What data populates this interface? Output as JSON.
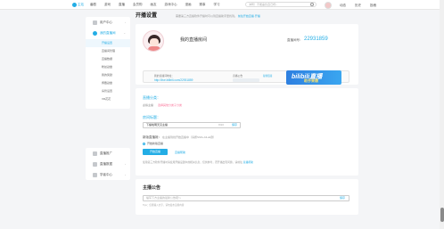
{
  "topbar": {
    "logo_text": "主站",
    "nav": [
      "番剧",
      "游戏",
      "直播",
      "会员购",
      "画友",
      "游戏中心",
      "漫画",
      "赛事",
      "学习"
    ],
    "search_placeholder": "冲鸭！不能辜负自己呀~",
    "right": [
      "动态",
      "历史",
      "投稿"
    ]
  },
  "sidebar": {
    "user_center": "用户中心",
    "live_center": "我的直播间",
    "sub_items": [
      "开播设置",
      "直播间管理",
      "直播数据",
      "粉丝勋章",
      "我的奖励",
      "佩戴勋章",
      "房管设置",
      "XR花花"
    ],
    "live_promo": "直播推广",
    "live_data": "直播数据",
    "my_center": "学者中心"
  },
  "main": {
    "page_title": "开播设置",
    "notice": "需要第三方直播软件开播时可以到直播助手里找到。",
    "notice_link": "前往开始直播·开播",
    "room": {
      "name": "我的直播房间",
      "id_label": "直播间号：",
      "id": "22931859",
      "link_label": "我的直播间地址：",
      "url": "http://live.bilibili.com/22931859",
      "share_label": "直播公告",
      "copy": "复制链接",
      "banner_title": "bilibili直播",
      "banner_sub": "助手来袭"
    },
    "category": {
      "label": "直播分类：",
      "selected": "虚拟主播",
      "change": "选择其他分类子分类"
    },
    "title": {
      "label": "房间标题：",
      "value": "下播啦明天见主播",
      "count": "8/20",
      "save": "保存"
    },
    "start": {
      "label": "新版直播姬：",
      "note": "在主播到线开始直播中（请按Shift+Alt+E键）",
      "radio": "开始新版直播",
      "button": "开始直播",
      "guide": "直播帮助"
    },
    "footnote": "使用第三方软件开播时请使用开播设置中的相关信息，仅供参考，若开播出现问题，请前往",
    "footnote_link": "直播帮助",
    "announce": {
      "title": "主播公告",
      "placeholder": "编写下方主播的最新公告吧～",
      "save": "保存",
      "hint": "Tips：仅能输入文字，请勿发布违规内容"
    }
  },
  "colors": {
    "accent": "#23ade5",
    "pink": "#fb7299"
  }
}
